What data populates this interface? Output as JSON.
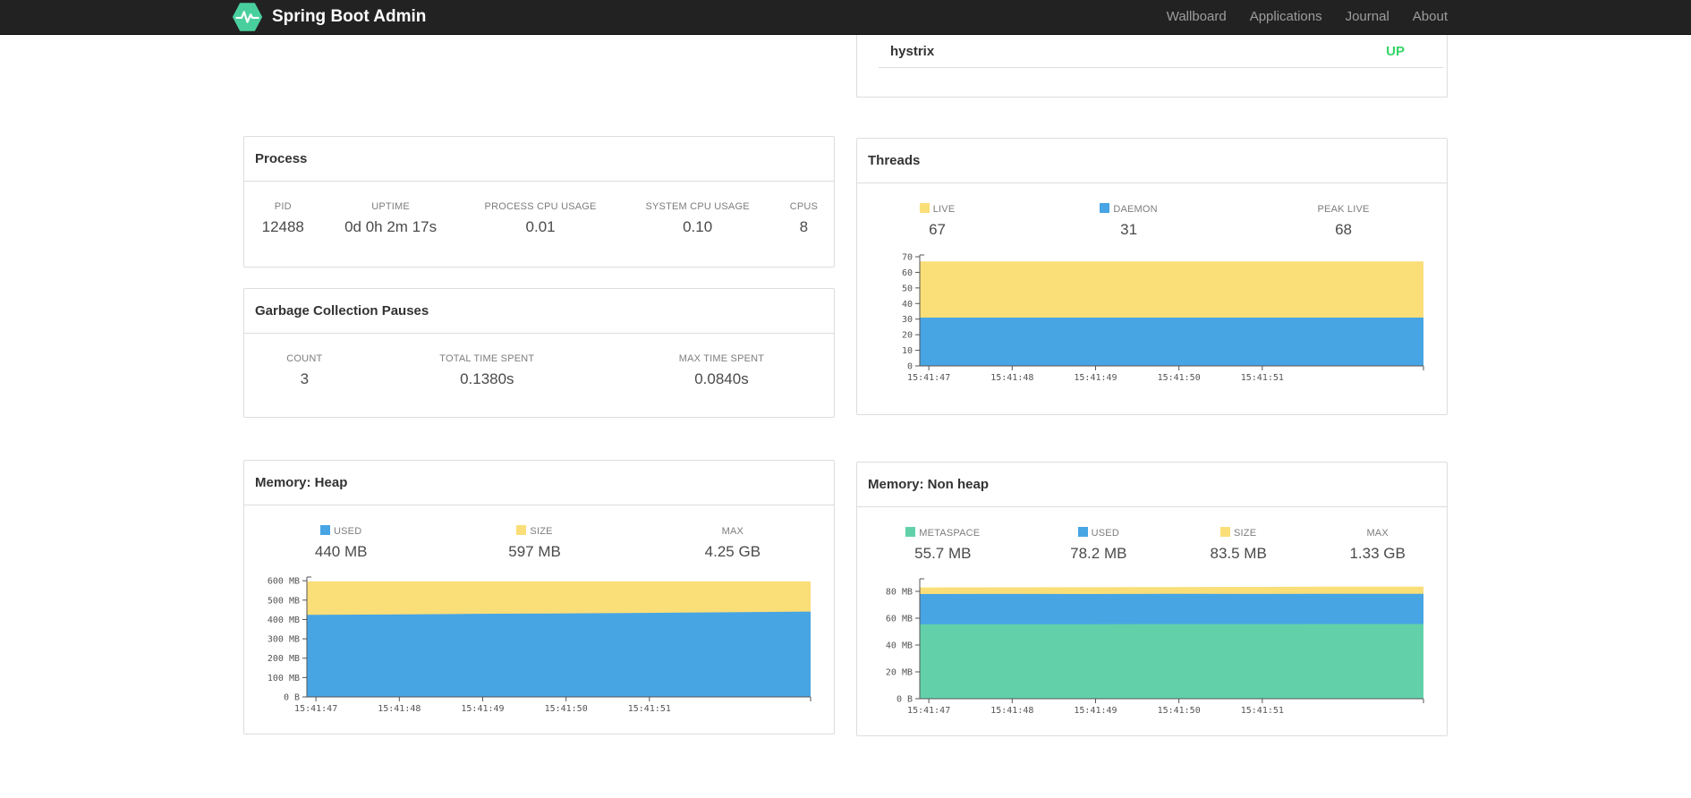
{
  "navbar": {
    "brand": "Spring Boot Admin",
    "links": [
      "Wallboard",
      "Applications",
      "Journal",
      "About"
    ]
  },
  "applications_panel": {
    "rows": [
      {
        "name": "hystrix",
        "status": "UP"
      }
    ]
  },
  "panels": {
    "process": {
      "title": "Process",
      "stats": [
        {
          "label": "PID",
          "value": "12488"
        },
        {
          "label": "UPTIME",
          "value": "0d 0h 2m 17s"
        },
        {
          "label": "PROCESS CPU USAGE",
          "value": "0.01"
        },
        {
          "label": "SYSTEM CPU USAGE",
          "value": "0.10"
        },
        {
          "label": "CPUS",
          "value": "8"
        }
      ]
    },
    "gc": {
      "title": "Garbage Collection Pauses",
      "stats": [
        {
          "label": "COUNT",
          "value": "3"
        },
        {
          "label": "TOTAL TIME SPENT",
          "value": "0.1380s"
        },
        {
          "label": "MAX TIME SPENT",
          "value": "0.0840s"
        }
      ]
    },
    "threads": {
      "title": "Threads",
      "stats": [
        {
          "label": "LIVE",
          "value": "67",
          "color": "#fade78"
        },
        {
          "label": "DAEMON",
          "value": "31",
          "color": "#48a5e4"
        },
        {
          "label": "PEAK LIVE",
          "value": "68"
        }
      ]
    },
    "heap": {
      "title": "Memory: Heap",
      "stats": [
        {
          "label": "USED",
          "value": "440 MB",
          "color": "#48a5e4"
        },
        {
          "label": "SIZE",
          "value": "597 MB",
          "color": "#fade78"
        },
        {
          "label": "MAX",
          "value": "4.25 GB"
        }
      ]
    },
    "nonheap": {
      "title": "Memory: Non heap",
      "stats": [
        {
          "label": "METASPACE",
          "value": "55.7 MB",
          "color": "#62d1a9"
        },
        {
          "label": "USED",
          "value": "78.2 MB",
          "color": "#48a5e4"
        },
        {
          "label": "SIZE",
          "value": "83.5 MB",
          "color": "#fade78"
        },
        {
          "label": "MAX",
          "value": "1.33 GB"
        }
      ]
    }
  },
  "colors": {
    "brand_green": "#49cf9e",
    "status_up": "#35d467",
    "series_blue": "#48a5e4",
    "series_yellow": "#fade78",
    "series_green": "#62d1a9",
    "navbar_bg": "#222222",
    "panel_border": "#dddddd"
  },
  "chart_data": [
    {
      "id": "threads",
      "type": "area",
      "title": "Threads",
      "unit": "threads",
      "grid": false,
      "legend_position": "top",
      "paint_order": "first series painted at back",
      "x_ticks": [
        "15:41:47",
        "15:41:48",
        "15:41:49",
        "15:41:50",
        "15:41:51"
      ],
      "ylim": [
        0,
        70
      ],
      "y_ticks": [
        {
          "v": 0,
          "label": "0"
        },
        {
          "v": 10,
          "label": "10"
        },
        {
          "v": 20,
          "label": "20"
        },
        {
          "v": 30,
          "label": "30"
        },
        {
          "v": 40,
          "label": "40"
        },
        {
          "v": 50,
          "label": "50"
        },
        {
          "v": 60,
          "label": "60"
        },
        {
          "v": 70,
          "label": "70"
        }
      ],
      "series": [
        {
          "name": "LIVE",
          "color": "#fade78",
          "values": [
            67,
            67,
            67,
            67,
            67,
            67,
            67
          ]
        },
        {
          "name": "DAEMON",
          "color": "#48a5e4",
          "values": [
            31,
            31,
            31,
            31,
            31,
            31,
            31
          ]
        }
      ]
    },
    {
      "id": "heap",
      "type": "area",
      "title": "Memory: Heap",
      "unit": "MB",
      "grid": false,
      "legend_position": "top",
      "paint_order": "first series painted at back",
      "x_ticks": [
        "15:41:47",
        "15:41:48",
        "15:41:49",
        "15:41:50",
        "15:41:51"
      ],
      "ylim": [
        0,
        610
      ],
      "y_ticks": [
        {
          "v": 0,
          "label": "0 B"
        },
        {
          "v": 100,
          "label": "100 MB"
        },
        {
          "v": 200,
          "label": "200 MB"
        },
        {
          "v": 300,
          "label": "300 MB"
        },
        {
          "v": 400,
          "label": "400 MB"
        },
        {
          "v": 500,
          "label": "500 MB"
        },
        {
          "v": 600,
          "label": "600 MB"
        }
      ],
      "series": [
        {
          "name": "SIZE",
          "color": "#fade78",
          "values": [
            597,
            597,
            597,
            597,
            597,
            597,
            597
          ]
        },
        {
          "name": "USED",
          "color": "#48a5e4",
          "values": [
            424,
            426,
            429,
            431,
            434,
            437,
            441
          ]
        }
      ]
    },
    {
      "id": "nonheap",
      "type": "area",
      "title": "Memory: Non heap",
      "unit": "MB",
      "grid": false,
      "legend_position": "top",
      "paint_order": "first series painted at back",
      "x_ticks": [
        "15:41:47",
        "15:41:48",
        "15:41:49",
        "15:41:50",
        "15:41:51"
      ],
      "ylim": [
        0,
        88
      ],
      "y_ticks": [
        {
          "v": 0,
          "label": "0 B"
        },
        {
          "v": 20,
          "label": "20 MB"
        },
        {
          "v": 40,
          "label": "40 MB"
        },
        {
          "v": 60,
          "label": "60 MB"
        },
        {
          "v": 80,
          "label": "80 MB"
        }
      ],
      "series": [
        {
          "name": "SIZE",
          "color": "#fade78",
          "values": [
            82.9,
            83.0,
            83.1,
            83.2,
            83.3,
            83.5,
            83.5
          ]
        },
        {
          "name": "USED",
          "color": "#48a5e4",
          "values": [
            78.0,
            78.1,
            78.0,
            78.2,
            78.1,
            78.2,
            78.2
          ]
        },
        {
          "name": "METASPACE",
          "color": "#62d1a9",
          "values": [
            55.5,
            55.5,
            55.5,
            55.6,
            55.6,
            55.7,
            55.7
          ]
        }
      ]
    }
  ]
}
